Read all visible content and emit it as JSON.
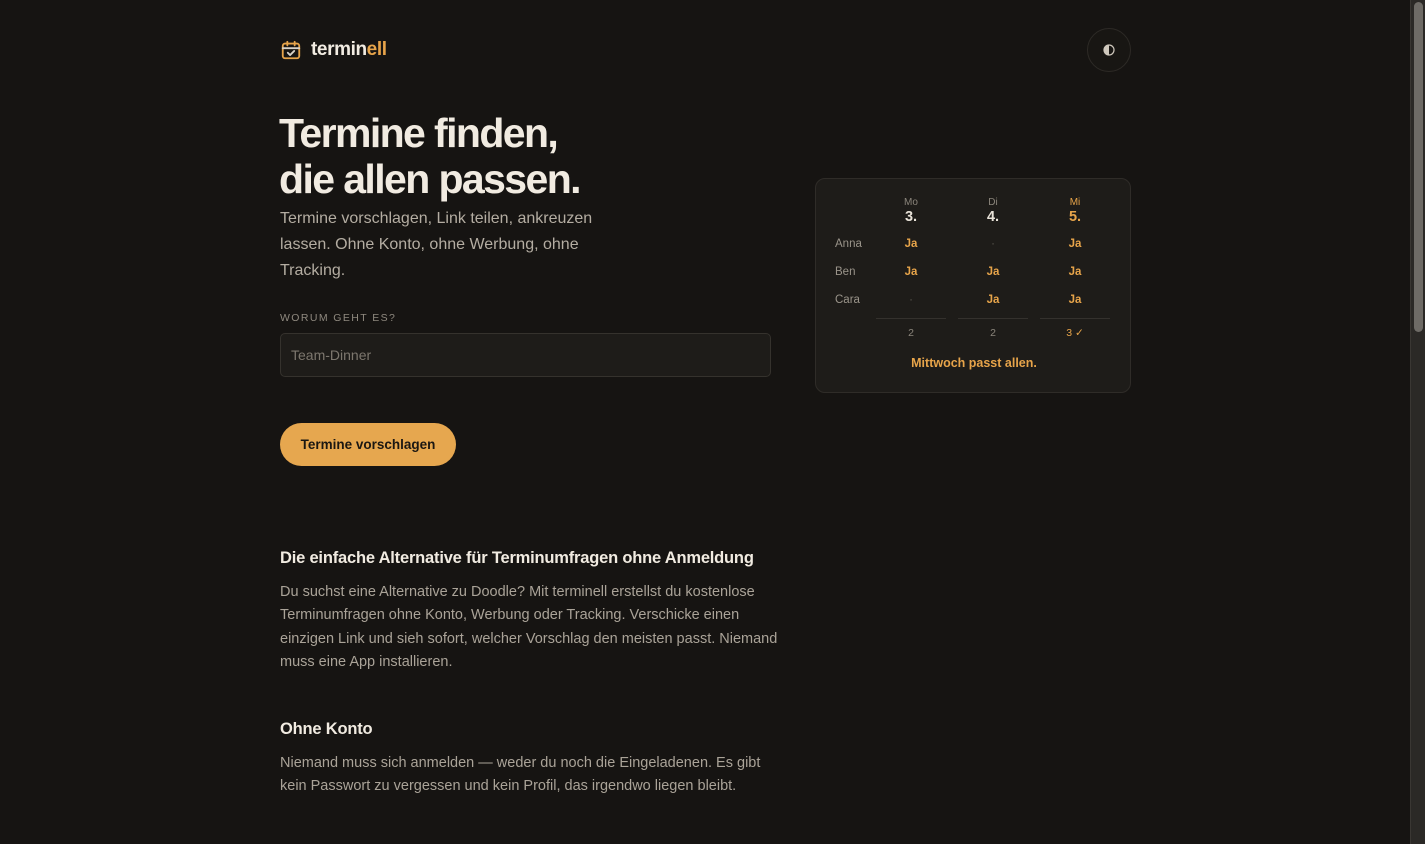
{
  "brand": {
    "name_prefix": "termin",
    "name_accent": "ell",
    "accent_color": "#e7a44a"
  },
  "theme_toggle": {
    "icon": "contrast-icon"
  },
  "hero": {
    "title_line1": "Termine finden,",
    "title_line2": "die allen passen.",
    "subtitle": "Termine vorschlagen, Link teilen, ankreuzen lassen. Ohne Konto, ohne Werbung, ohne Tracking."
  },
  "form": {
    "label": "WORUM GEHT ES?",
    "placeholder": "Team-Dinner",
    "value": "",
    "submit_label": "Termine vorschlagen"
  },
  "poll_preview": {
    "days": [
      {
        "name": "Mo",
        "num": "3."
      },
      {
        "name": "Di",
        "num": "4."
      },
      {
        "name": "Mi",
        "num": "5."
      }
    ],
    "rows": [
      {
        "name": "Anna",
        "cells": [
          "Ja",
          "·",
          "Ja"
        ]
      },
      {
        "name": "Ben",
        "cells": [
          "Ja",
          "Ja",
          "Ja"
        ]
      },
      {
        "name": "Cara",
        "cells": [
          "·",
          "Ja",
          "Ja"
        ]
      }
    ],
    "totals": [
      "2",
      "2",
      "3 ✓"
    ],
    "result": "Mittwoch passt allen."
  },
  "sections": [
    {
      "heading": "Die einfache Alternative für Terminumfragen ohne Anmeldung",
      "body": "Du suchst eine Alternative zu Doodle? Mit terminell erstellst du kostenlose Terminumfragen ohne Konto, Werbung oder Tracking. Verschicke einen einzigen Link und sieh sofort, welcher Vorschlag den meisten passt. Niemand muss eine App installieren."
    },
    {
      "heading": "Ohne Konto",
      "body": "Niemand muss sich anmelden — weder du noch die Eingeladenen. Es gibt kein Passwort zu vergessen und kein Profil, das irgendwo liegen bleibt."
    }
  ]
}
